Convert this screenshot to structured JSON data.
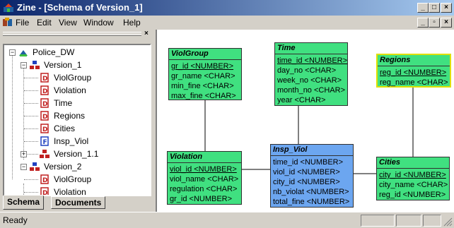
{
  "window": {
    "title": "Zine - [Schema of Version_1]",
    "minimize": "_",
    "maximize": "□",
    "close": "×"
  },
  "menu": {
    "items": [
      "File",
      "Edit",
      "View",
      "Window",
      "Help"
    ],
    "mdi_minimize": "_",
    "mdi_restore": "▫",
    "mdi_close": "×"
  },
  "panel": {
    "close": "×"
  },
  "tree": {
    "root": "Police_DW",
    "version1": "Version_1",
    "v1_items": [
      "ViolGroup",
      "Violation",
      "Time",
      "Regions",
      "Cities"
    ],
    "insp": "Insp_Viol",
    "version11": "Version_1.1",
    "version2": "Version_2",
    "v2_items": [
      "ViolGroup",
      "Violation"
    ]
  },
  "tabs": [
    "Schema",
    "Documents"
  ],
  "entities": {
    "violgroup": {
      "name": "ViolGroup",
      "attrs": [
        "gr_id <NUMBER>",
        "gr_name <CHAR>",
        "min_fine <CHAR>",
        "max_fine <CHAR>"
      ]
    },
    "time": {
      "name": "Time",
      "attrs": [
        "time_id <NUMBER>",
        "day_no <CHAR>",
        "week_no <CHAR>",
        "month_no <CHAR>",
        "year <CHAR>"
      ]
    },
    "regions": {
      "name": "Regions",
      "attrs": [
        "reg_id <NUMBER>",
        "reg_name <CHAR>"
      ]
    },
    "violation": {
      "name": "Violation",
      "attrs": [
        "viol_id <NUMBER>",
        "viol_name <CHAR>",
        "regulation <CHAR>",
        "gr_id <NUMBER>"
      ]
    },
    "insp_viol": {
      "name": "Insp_Viol",
      "attrs": [
        "time_id <NUMBER>",
        "viol_id <NUMBER>",
        "city_id <NUMBER>",
        "nb_violat <NUMBER>",
        "total_fine <NUMBER>"
      ]
    },
    "cities": {
      "name": "Cities",
      "attrs": [
        "city_id <NUMBER>",
        "city_name <CHAR>",
        "reg_id <NUMBER>"
      ]
    }
  },
  "status": {
    "text": "Ready"
  },
  "colors": {
    "entity": "#40e080",
    "fact": "#6ca6f0",
    "selected_border": "#e0e000"
  }
}
